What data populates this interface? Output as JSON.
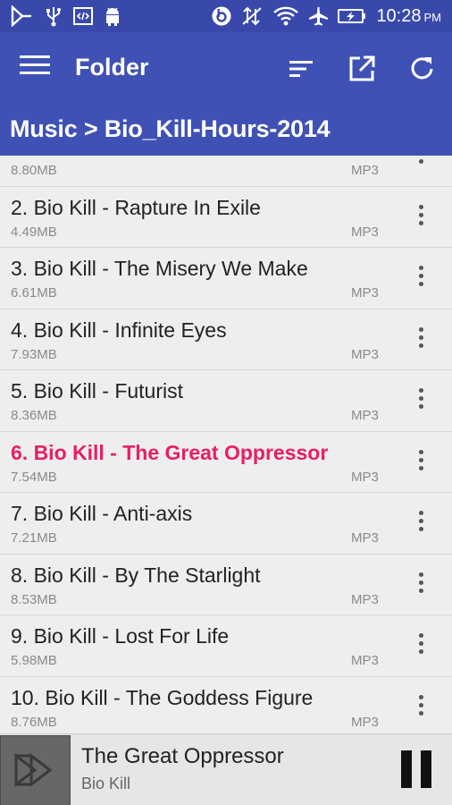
{
  "status_bar": {
    "time": "10:28",
    "ampm": "PM",
    "icons": [
      "play-store-icon",
      "usb-icon",
      "code-icon",
      "android-icon",
      "beats-icon",
      "data-off-icon",
      "wifi-icon",
      "airplane-icon",
      "battery-charging-icon"
    ]
  },
  "app_bar": {
    "title": "Folder",
    "icons": [
      "menu-icon",
      "sort-icon",
      "open-external-icon",
      "refresh-icon"
    ]
  },
  "path": "Music > Bio_Kill-Hours-2014",
  "tracks": [
    {
      "title": "",
      "size": "8.80MB",
      "type": "MP3"
    },
    {
      "title": "2. Bio Kill - Rapture In Exile",
      "size": "4.49MB",
      "type": "MP3"
    },
    {
      "title": "3. Bio Kill - The Misery We Make",
      "size": "6.61MB",
      "type": "MP3"
    },
    {
      "title": "4. Bio Kill - Infinite Eyes",
      "size": "7.93MB",
      "type": "MP3"
    },
    {
      "title": "5. Bio Kill - Futurist",
      "size": "8.36MB",
      "type": "MP3"
    },
    {
      "title": "6. Bio Kill - The Great Oppressor",
      "size": "7.54MB",
      "type": "MP3",
      "playing": true
    },
    {
      "title": "7. Bio Kill - Anti-axis",
      "size": "7.21MB",
      "type": "MP3"
    },
    {
      "title": "8. Bio Kill - By The Starlight",
      "size": "8.53MB",
      "type": "MP3"
    },
    {
      "title": "9. Bio Kill - Lost For Life",
      "size": "5.98MB",
      "type": "MP3"
    },
    {
      "title": "10. Bio Kill - The Goddess Figure",
      "size": "8.76MB",
      "type": "MP3"
    }
  ],
  "now_playing": {
    "title": "The Great Oppressor",
    "artist": "Bio Kill"
  },
  "colors": {
    "status_bar": "#3949ab",
    "app_bar": "#3f51b5",
    "accent": "#e91e63",
    "background": "#eeeeee"
  }
}
